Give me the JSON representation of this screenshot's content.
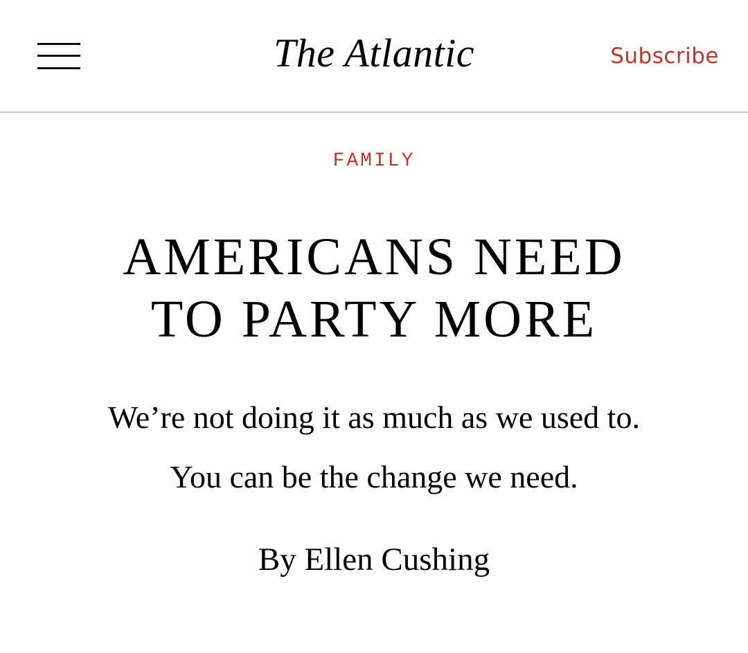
{
  "header": {
    "logo": "The Atlantic",
    "subscribe_label": "Subscribe",
    "menu_icon": "hamburger-menu-icon"
  },
  "article": {
    "section": "FAMILY",
    "headline_line1": "AMERICANS NEED",
    "headline_line2": "TO PARTY MORE",
    "dek_line1": "We’re not doing it as much as we used to.",
    "dek_line2": "You can be the change we need.",
    "byline_prefix": "By",
    "author": "Ellen Cushing"
  },
  "colors": {
    "accent": "#c2352b",
    "text": "#000000",
    "divider": "#c9c9c9",
    "background": "#ffffff"
  }
}
